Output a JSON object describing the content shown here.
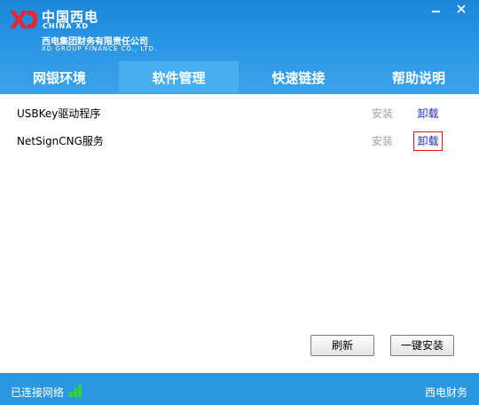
{
  "header": {
    "logo_cn": "中国西电",
    "logo_en": "CHINA XD",
    "company_name": "西电集团财务有限责任公司",
    "company_name_en": "XD GROUP FINANCE CO., LTD."
  },
  "window": {
    "minimize_icon": "minimize-icon",
    "close_icon": "close-icon"
  },
  "tabs": [
    {
      "label": "网银环境",
      "active": false
    },
    {
      "label": "软件管理",
      "active": true
    },
    {
      "label": "快速链接",
      "active": false
    },
    {
      "label": "帮助说明",
      "active": false
    }
  ],
  "software": [
    {
      "name": "USBKey驱动程序",
      "install": "安装",
      "uninstall": "卸载"
    },
    {
      "name": "NetSignCNG服务",
      "install": "安装",
      "uninstall": "卸载"
    }
  ],
  "buttons": {
    "refresh": "刷新",
    "install_all": "一键安装"
  },
  "footer": {
    "status": "已连接网络",
    "brand": "西电财务",
    "signal_color": "#2fd43a"
  },
  "colors": {
    "header": "#2a95e3",
    "active_tab": "#47aef0",
    "footer": "#2b97e2",
    "link": "#1f2fb8",
    "focus_border": "#e01515"
  }
}
